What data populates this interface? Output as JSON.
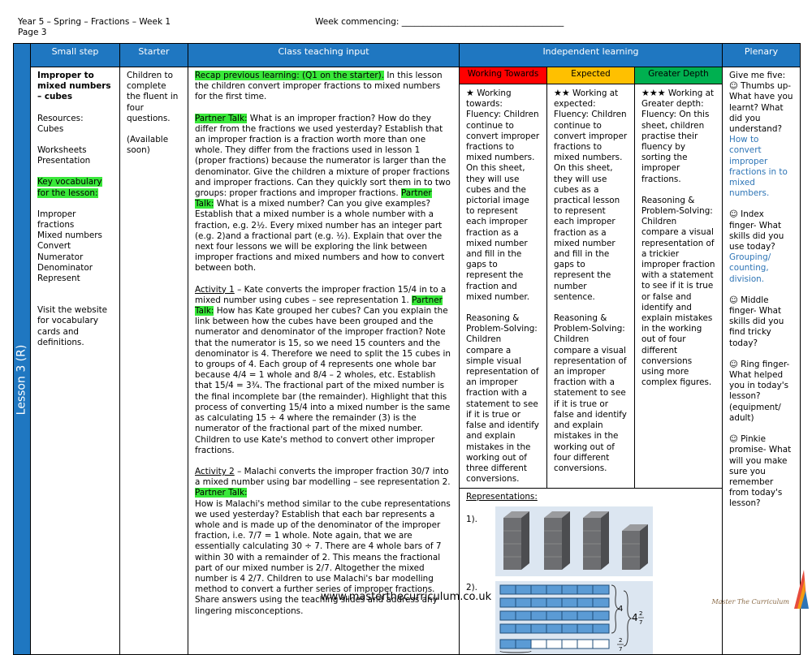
{
  "header": {
    "title": "Year 5 – Spring – Fractions – Week 1",
    "page": "Page 3",
    "week_commencing": "Week commencing: ______________________________________"
  },
  "columns": {
    "small_step": "Small step",
    "starter": "Starter",
    "class_teaching": "Class teaching input",
    "independent": "Independent learning",
    "plenary": "Plenary"
  },
  "lesson_label": "Lesson 3 (R)",
  "small_step": {
    "title": "Improper to mixed numbers – cubes",
    "resources_label": "Resources:",
    "resources": "Cubes",
    "worksheets": "Worksheets",
    "presentation": "Presentation",
    "key_vocab": "Key vocabulary for the lesson:",
    "vocab": [
      "Improper fractions",
      "Mixed numbers",
      "Convert",
      "Numerator",
      "Denominator",
      "Represent"
    ],
    "visit": "Visit the website for vocabulary cards and definitions."
  },
  "starter": {
    "text": "Children to complete the fluent in four questions.",
    "available": "(Available soon)"
  },
  "teaching": {
    "recap_hl": "Recap previous learning: (Q1 on the starter).",
    "recap_rest": " In this lesson the children convert improper fractions to mixed numbers for the first time.",
    "pt1_hl": "Partner Talk:",
    "pt1_text": " What is an improper fraction? How do they differ from the fractions we used yesterday? Establish that an improper fraction is a fraction worth more than one whole. They differ from the fractions used in lesson 1 (proper fractions) because the numerator is larger than the denominator. Give the children a mixture of proper fractions and improper fractions. Can they quickly sort them in to two groups: proper fractions and improper fractions. ",
    "pt2_hl": "Partner Talk:",
    "pt2_text": " What is a mixed number? Can you give examples? Establish that a mixed number is a whole number with a fraction, e.g. 2½. Every mixed number has an integer part (e.g. 2)and a fractional part (e.g. ½). Explain that over the next four lessons we will be exploring the link between improper fractions and mixed numbers and how to convert between both.",
    "act1_label": "Activity 1",
    "act1_text": " – Kate converts the improper fraction 15/4 in to a mixed number using cubes – see representation 1. ",
    "act1_hl": "Partner Talk:",
    "act1_rest": " How has Kate grouped her cubes? Can you explain the link between how the cubes have been grouped and the numerator and denominator of the improper fraction? Note that the numerator is 15, so we need 15 counters and the denominator is 4. Therefore we need to split the 15 cubes in to groups of 4. Each group of 4 represents one whole bar because 4/4 = 1 whole and 8/4 – 2 wholes, etc. Establish that 15/4 = 3¾. The fractional part of the mixed number is the final incomplete bar (the remainder). Highlight that this process of converting 15/4 into a mixed number is the same as calculating 15 ÷ 4 where the remainder (3) is the numerator of the fractional part of the mixed number. Children to use Kate's method to convert other improper fractions.",
    "act2_label": "Activity 2",
    "act2_text": " – Malachi converts the improper fraction 30/7 into a mixed number using bar modelling – see representation 2. ",
    "act2_hl": "Partner Talk:",
    "act2_rest": "How is Malachi's method similar to the cube representations we used yesterday? Establish that each bar represents a whole and is made up of the denominator of the improper fraction, i.e. 7/7 = 1 whole. Note again, that we are essentially calculating 30 ÷ 7. There are 4 whole bars of 7 within 30 with a remainder of 2. This means the fractional part of our mixed number is 2/7. Altogether the mixed number is 4 2/7. Children to use Malachi's bar modelling method to convert a further series of improper fractions. Share answers using the teaching slides and address any lingering misconceptions."
  },
  "independent": {
    "wt_label": "Working Towards",
    "exp_label": "Expected",
    "gd_label": "Greater Depth",
    "wt_colour": "#ff0000",
    "exp_colour": "#ffc000",
    "gd_colour": "#00b050",
    "wt_intro": "Working towards:",
    "wt_fluency": "Fluency: Children continue to convert improper fractions to mixed numbers. On this sheet, they will use cubes and the pictorial image to represent each improper fraction as a mixed number and fill in the gaps to represent the fraction and mixed number.",
    "wt_reasoning": "Reasoning & Problem-Solving: Children compare a simple visual representation of an improper fraction with a statement to see if it is true or false and identify and explain mistakes in the working out of three different conversions.",
    "exp_intro": "Working at expected:",
    "exp_fluency": "Fluency: Children continue to convert improper fractions to mixed numbers. On this sheet, they will use cubes as a practical lesson to represent each improper fraction as a mixed number and fill in the gaps to represent the number sentence.",
    "exp_reasoning": "Reasoning & Problem-Solving: Children compare a visual representation of an improper fraction with a statement to see if it is true or false and identify and explain mistakes in the working out of four different conversions.",
    "gd_intro": "Working at Greater depth:",
    "gd_fluency": "Fluency: On this sheet, children practise their fluency by sorting the improper fractions.",
    "gd_reasoning": "Reasoning & Problem-Solving: Children compare a visual representation of a trickier improper fraction with a statement to see if it is true or false and identify and explain mistakes in the working out of four different conversions using more complex figures.",
    "representations": "Representations:",
    "rep1": "1).",
    "rep2": "2).",
    "bar_label": "4",
    "mixed_whole": "4",
    "mixed_num": "2",
    "mixed_den": "7",
    "rem_num": "2",
    "rem_den": "7"
  },
  "plenary": {
    "intro": "Give me five:",
    "thumb": "Thumbs up- What have you learnt? What did you understand?",
    "thumb_blue": "How to convert improper fractions in to mixed numbers.",
    "index": "Index finger- What skills did you use today?",
    "index_blue": "Grouping/ counting, division.",
    "middle": "Middle finger- What skills did you find tricky today?",
    "ring": "Ring finger- What helped you in today's lesson? (equipment/ adult)",
    "pinkie": "Pinkie promise- What will you make sure you remember from today's lesson?"
  },
  "footer": {
    "url": "www.masterthecurriculum.co.uk",
    "signature": "Master The Curriculum"
  }
}
